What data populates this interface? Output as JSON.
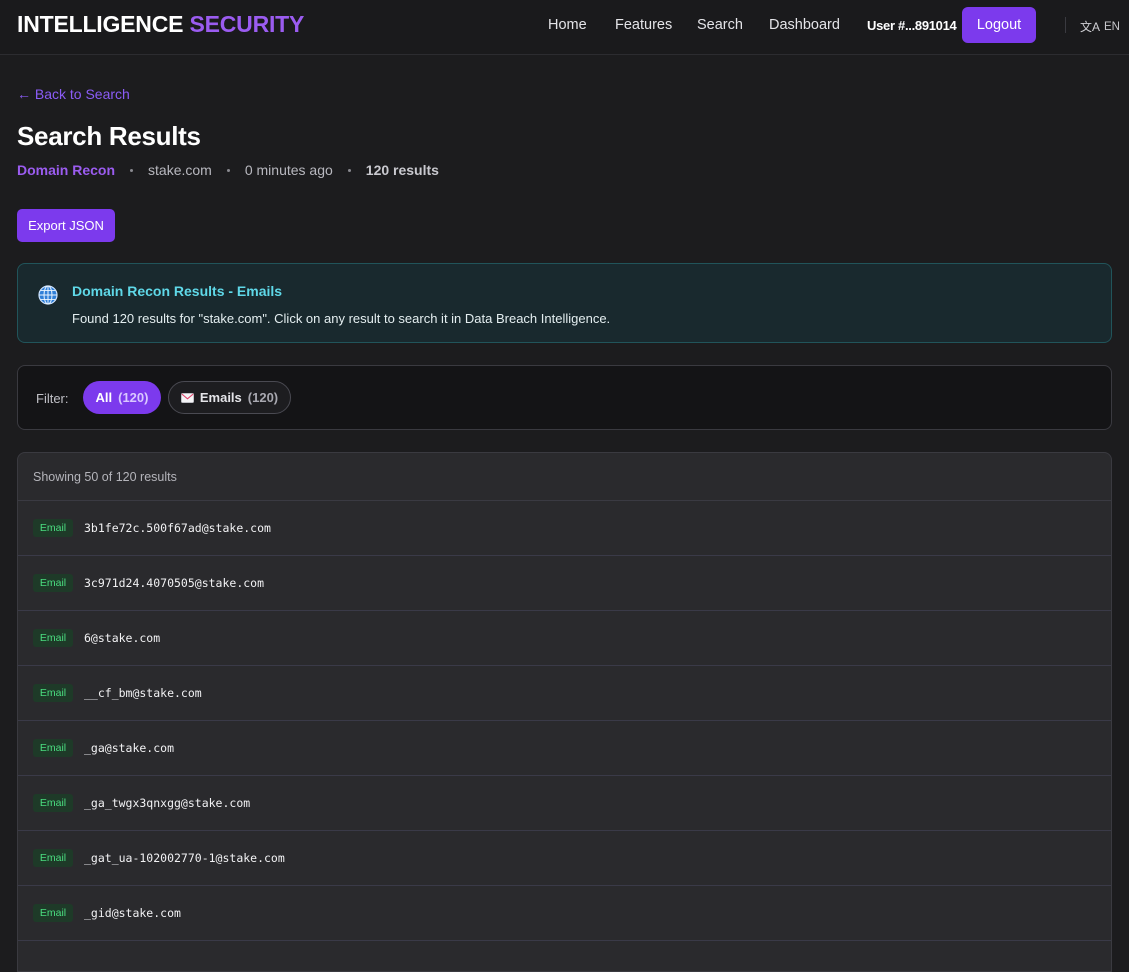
{
  "header": {
    "brand_main": "INTELLIGENCE",
    "brand_accent": "SECURITY",
    "nav": [
      "Home",
      "Features",
      "Search",
      "Dashboard"
    ],
    "user_label": "User #...891014",
    "logout_label": "Logout",
    "language": "EN"
  },
  "page": {
    "back_label": "← Back to Search",
    "title": "Search Results",
    "meta": {
      "type": "Domain Recon",
      "query": "stake.com",
      "time": "0 minutes ago",
      "count": "120 results"
    },
    "export_label": "Export JSON"
  },
  "info": {
    "title": "Domain Recon Results - Emails",
    "text": "Found 120 results for \"stake.com\". Click on any result to search it in Data Breach Intelligence."
  },
  "filter": {
    "label": "Filter:",
    "chips": [
      {
        "label": "All",
        "count": "(120)"
      },
      {
        "label": "Emails",
        "count": "(120)"
      }
    ]
  },
  "results": {
    "summary": "Showing 50 of 120 results",
    "badge_label": "Email",
    "items": [
      "3b1fe72c.500f67ad@stake.com",
      "3c971d24.4070505@stake.com",
      "6@stake.com",
      "__cf_bm@stake.com",
      "_ga@stake.com",
      "_ga_twgx3qnxgg@stake.com",
      "_gat_ua-102002770-1@stake.com",
      "_gid@stake.com",
      ""
    ]
  },
  "colors": {
    "accent": "#7c3aed",
    "info_title": "#5fd8e8",
    "badge_text": "#4ade80"
  }
}
